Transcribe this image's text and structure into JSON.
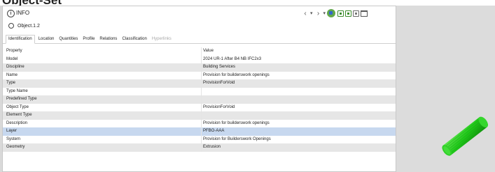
{
  "cutoff_title": "Object-Set",
  "panel": {
    "title": "INFO",
    "object_name": "Object.1.2"
  },
  "toolbar": {
    "prev": "‹",
    "next": "›",
    "dropdown": "▾"
  },
  "tabs": [
    {
      "label": "Identification",
      "active": true
    },
    {
      "label": "Location"
    },
    {
      "label": "Quantities"
    },
    {
      "label": "Profile"
    },
    {
      "label": "Relations"
    },
    {
      "label": "Classification"
    },
    {
      "label": "Hyperlinks",
      "disabled": true
    }
  ],
  "table": {
    "headers": {
      "property": "Property",
      "value": "Value"
    },
    "rows": [
      {
        "property": "Model",
        "value": "2024 UR-1 After B4 NB IFC2x3"
      },
      {
        "property": "Discipline",
        "value": "Building Services"
      },
      {
        "property": "Name",
        "value": "Provision for builderswork openings"
      },
      {
        "property": "Type",
        "value": "ProvisionForVoid"
      },
      {
        "property": "Type Name",
        "value": ""
      },
      {
        "property": "Predefined Type",
        "value": ""
      },
      {
        "property": "Object Type",
        "value": "ProvisionForVoid"
      },
      {
        "property": "Element Type",
        "value": ""
      },
      {
        "property": "Description",
        "value": "Provision for builderswork openings"
      },
      {
        "property": "Layer",
        "value": "PFBO-AAA",
        "selected": true
      },
      {
        "property": "System",
        "value": "Provision for Builderswork Openings"
      },
      {
        "property": "Geometry",
        "value": "Extrusion"
      }
    ]
  },
  "colors": {
    "selected_row": "#c7d8ef",
    "stripe": "#e6e6e6",
    "object_green": "#22c21e"
  }
}
